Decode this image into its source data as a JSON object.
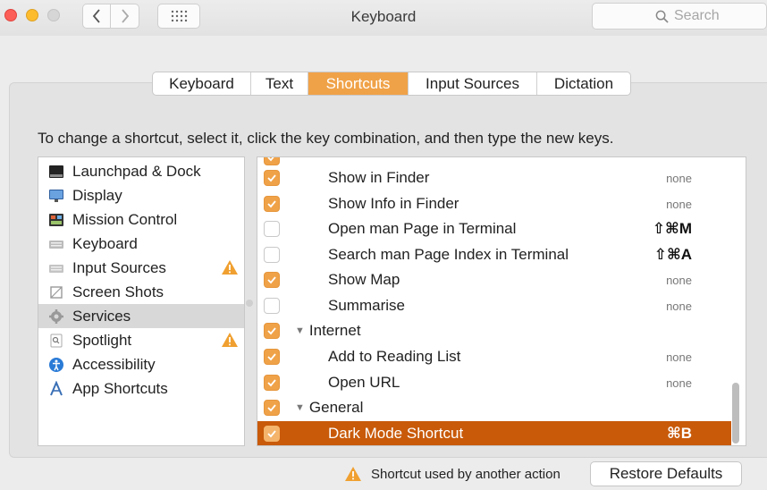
{
  "window": {
    "title": "Keyboard",
    "search_placeholder": "Search"
  },
  "tabs": [
    {
      "label": "Keyboard",
      "active": false
    },
    {
      "label": "Text",
      "active": false
    },
    {
      "label": "Shortcuts",
      "active": true
    },
    {
      "label": "Input Sources",
      "active": false
    },
    {
      "label": "Dictation",
      "active": false
    }
  ],
  "instructions": "To change a shortcut, select it, click the key combination, and then type the new keys.",
  "categories": [
    {
      "label": "Launchpad & Dock",
      "icon": "launchpad-dock-icon",
      "warning": false,
      "selected": false
    },
    {
      "label": "Display",
      "icon": "display-icon",
      "warning": false,
      "selected": false
    },
    {
      "label": "Mission Control",
      "icon": "mission-control-icon",
      "warning": false,
      "selected": false
    },
    {
      "label": "Keyboard",
      "icon": "keyboard-icon",
      "warning": false,
      "selected": false
    },
    {
      "label": "Input Sources",
      "icon": "input-sources-icon",
      "warning": true,
      "selected": false
    },
    {
      "label": "Screen Shots",
      "icon": "screen-shots-icon",
      "warning": false,
      "selected": false
    },
    {
      "label": "Services",
      "icon": "services-gear-icon",
      "warning": false,
      "selected": true
    },
    {
      "label": "Spotlight",
      "icon": "spotlight-icon",
      "warning": true,
      "selected": false
    },
    {
      "label": "Accessibility",
      "icon": "accessibility-icon",
      "warning": false,
      "selected": false
    },
    {
      "label": "App Shortcuts",
      "icon": "app-shortcuts-icon",
      "warning": false,
      "selected": false
    }
  ],
  "shortcuts": [
    {
      "kind": "item",
      "label": "Show in Finder",
      "checked": true,
      "key": "none"
    },
    {
      "kind": "item",
      "label": "Show Info in Finder",
      "checked": true,
      "key": "none"
    },
    {
      "kind": "item",
      "label": "Open man Page in Terminal",
      "checked": false,
      "key": "⇧⌘M"
    },
    {
      "kind": "item",
      "label": "Search man Page Index in Terminal",
      "checked": false,
      "key": "⇧⌘A"
    },
    {
      "kind": "item",
      "label": "Show Map",
      "checked": true,
      "key": "none"
    },
    {
      "kind": "item",
      "label": "Summarise",
      "checked": false,
      "key": "none"
    },
    {
      "kind": "group",
      "label": "Internet",
      "checked": true,
      "key": ""
    },
    {
      "kind": "item",
      "label": "Add to Reading List",
      "checked": true,
      "key": "none"
    },
    {
      "kind": "item",
      "label": "Open URL",
      "checked": true,
      "key": "none"
    },
    {
      "kind": "group",
      "label": "General",
      "checked": true,
      "key": ""
    },
    {
      "kind": "item",
      "label": "Dark Mode Shortcut",
      "checked": true,
      "key": "⌘B",
      "selected": true
    }
  ],
  "footer": {
    "conflict_note": "Shortcut used by another action",
    "restore_label": "Restore Defaults"
  },
  "colors": {
    "accent": "#f0a248",
    "selected_row": "#c85a0a",
    "warning": "#f0a030"
  }
}
